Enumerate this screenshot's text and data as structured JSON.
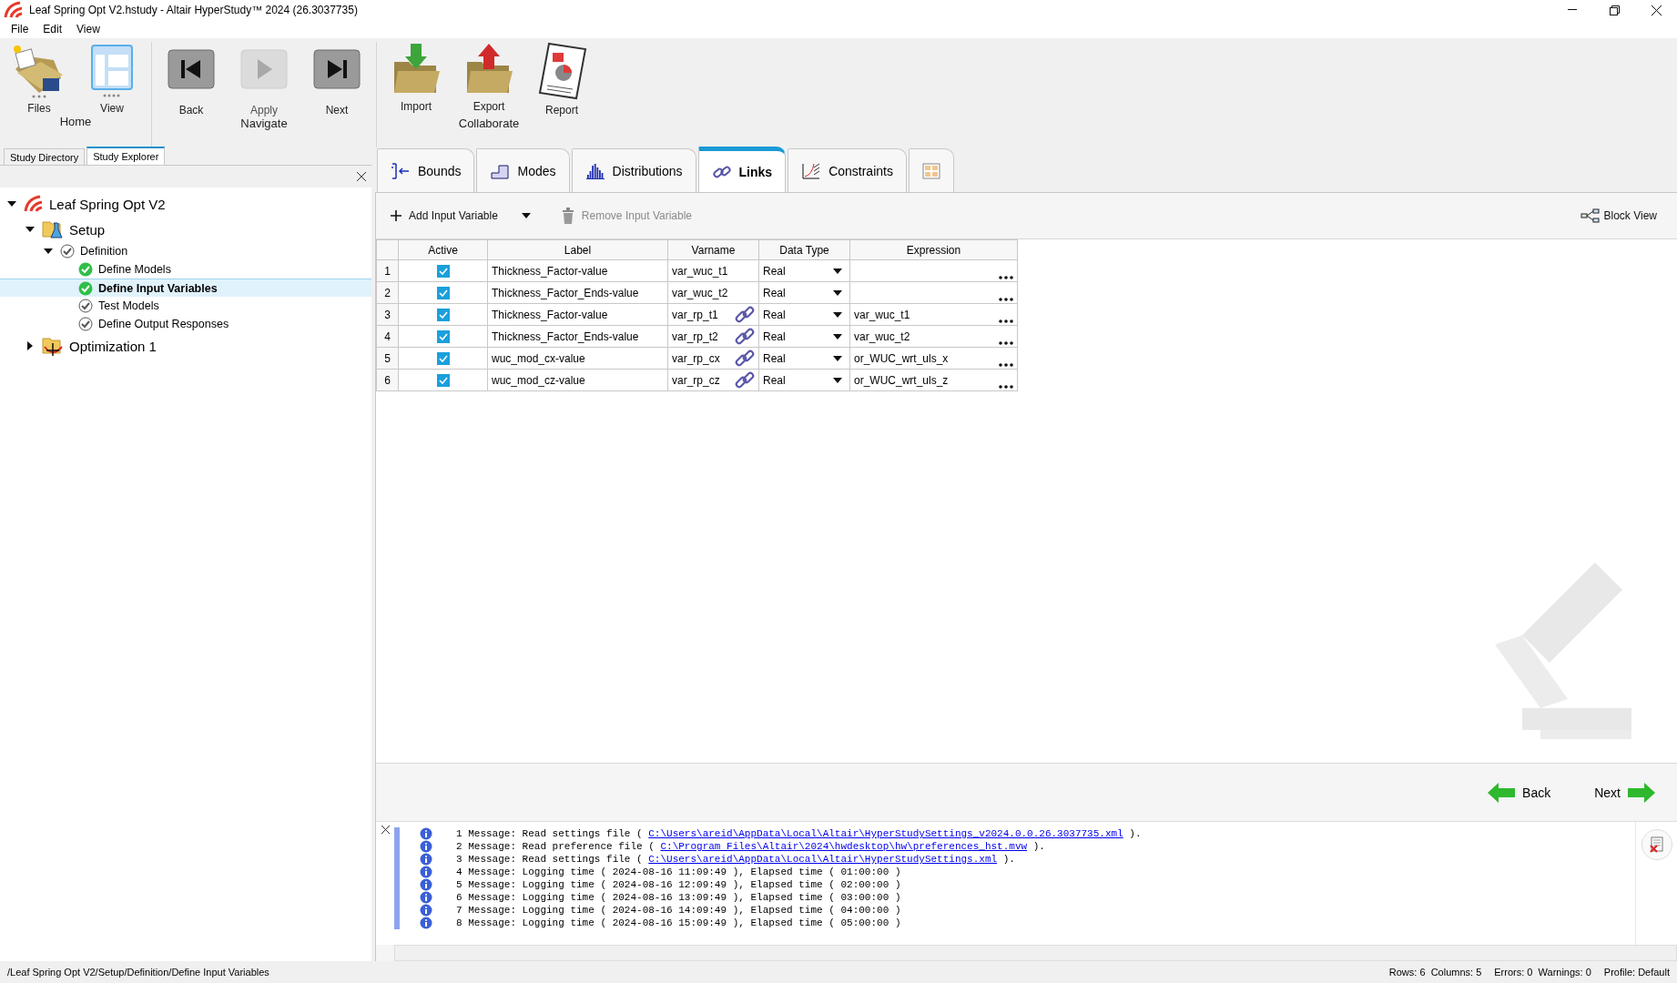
{
  "window": {
    "title": "Leaf Spring Opt V2.hstudy - Altair HyperStudy™ 2024 (26.3037735)"
  },
  "menu": [
    "File",
    "Edit",
    "View"
  ],
  "toolbar": [
    {
      "group": "Home",
      "buttons": [
        {
          "label": "Files",
          "kind": "files",
          "disabled": false
        },
        {
          "label": "View",
          "kind": "view",
          "disabled": false
        }
      ]
    },
    {
      "group": "Navigate",
      "buttons": [
        {
          "label": "Back",
          "kind": "back",
          "disabled": false
        },
        {
          "label": "Apply",
          "kind": "apply",
          "disabled": true
        },
        {
          "label": "Next",
          "kind": "next",
          "disabled": false
        }
      ]
    },
    {
      "group": "Collaborate",
      "buttons": [
        {
          "label": "Import",
          "kind": "import",
          "disabled": false
        },
        {
          "label": "Export",
          "kind": "export",
          "disabled": false
        },
        {
          "label": "Report",
          "kind": "report",
          "disabled": false
        }
      ]
    }
  ],
  "side_tabs": [
    {
      "label": "Study Directory",
      "selected": false
    },
    {
      "label": "Study Explorer",
      "selected": true
    }
  ],
  "tree": [
    {
      "label": "Leaf Spring Opt V2",
      "kind": "study",
      "expanded": true,
      "selected": false,
      "children": [
        {
          "label": "Setup",
          "kind": "setup",
          "expanded": true,
          "selected": false,
          "children": [
            {
              "label": "Definition",
              "kind": "step",
              "complete": false,
              "expanded": true,
              "selected": false,
              "children": [
                {
                  "label": "Define Models",
                  "kind": "step",
                  "complete": true,
                  "selected": false
                },
                {
                  "label": "Define Input Variables",
                  "kind": "step",
                  "complete": true,
                  "selected": true
                },
                {
                  "label": "Test Models",
                  "kind": "step",
                  "complete": false,
                  "selected": false
                },
                {
                  "label": "Define Output Responses",
                  "kind": "step",
                  "complete": false,
                  "selected": false
                }
              ]
            }
          ]
        },
        {
          "label": "Optimization 1",
          "kind": "optimization",
          "expanded": false,
          "selected": false
        }
      ]
    }
  ],
  "tabs": [
    {
      "label": "Bounds",
      "kind": "bounds",
      "selected": false
    },
    {
      "label": "Modes",
      "kind": "modes",
      "selected": false
    },
    {
      "label": "Distributions",
      "kind": "distributions",
      "selected": false
    },
    {
      "label": "Links",
      "kind": "links",
      "selected": true
    },
    {
      "label": "Constraints",
      "kind": "constraints",
      "selected": false
    },
    {
      "kind": "grid",
      "selected": false
    }
  ],
  "actions": [
    {
      "label": "Add Input Variable",
      "kind": "add",
      "disabled": false
    },
    {
      "label": "Remove Input Variable",
      "kind": "remove",
      "disabled": true
    }
  ],
  "block_view": "Block View",
  "table": {
    "columns": [
      "Active",
      "Label",
      "Varname",
      "Data Type",
      "Expression"
    ],
    "rows": [
      {
        "index": "1",
        "active": true,
        "label": "Thickness_Factor-value",
        "varname": "var_wuc_t1",
        "linked": false,
        "data_type": "Real"
      },
      {
        "index": "2",
        "active": true,
        "label": "Thickness_Factor_Ends-value",
        "varname": "var_wuc_t2",
        "linked": false,
        "data_type": "Real"
      },
      {
        "index": "3",
        "active": true,
        "label": "Thickness_Factor-value",
        "varname": "var_rp_t1",
        "linked": true,
        "data_type": "Real",
        "expression": "var_wuc_t1"
      },
      {
        "index": "4",
        "active": true,
        "label": "Thickness_Factor_Ends-value",
        "varname": "var_rp_t2",
        "linked": true,
        "data_type": "Real",
        "expression": "var_wuc_t2"
      },
      {
        "index": "5",
        "active": true,
        "label": "wuc_mod_cx-value",
        "varname": "var_rp_cx",
        "linked": true,
        "data_type": "Real",
        "expression": "or_WUC_wrt_uls_x"
      },
      {
        "index": "6",
        "active": true,
        "label": "wuc_mod_cz-value",
        "varname": "var_rp_cz",
        "linked": true,
        "data_type": "Real",
        "expression": "or_WUC_wrt_uls_z"
      }
    ]
  },
  "nav": {
    "back": "Back",
    "next": "Next"
  },
  "log": [
    {
      "text": "1 Message: Read settings file ( ",
      "link": "C:\\Users\\areid\\AppData\\Local\\Altair\\HyperStudySettings_v2024.0.0.26.3037735.xml",
      "suffix": " )."
    },
    {
      "text": "2 Message: Read preference file ( ",
      "link": "C:\\Program Files\\Altair\\2024\\hwdesktop\\hw\\preferences_hst.mvw",
      "suffix": " )."
    },
    {
      "text": "3 Message: Read settings file ( ",
      "link": "C:\\Users\\areid\\AppData\\Local\\Altair\\HyperStudySettings.xml",
      "suffix": " )."
    },
    {
      "text": "4 Message: Logging time ( 2024-08-16 11:09:49 ), Elapsed time ( 01:00:00 )"
    },
    {
      "text": "5 Message: Logging time ( 2024-08-16 12:09:49 ), Elapsed time ( 02:00:00 )"
    },
    {
      "text": "6 Message: Logging time ( 2024-08-16 13:09:49 ), Elapsed time ( 03:00:00 )"
    },
    {
      "text": "7 Message: Logging time ( 2024-08-16 14:09:49 ), Elapsed time ( 04:00:00 )"
    },
    {
      "text": "8 Message: Logging time ( 2024-08-16 15:09:49 ), Elapsed time ( 05:00:00 )"
    }
  ],
  "status_bar": {
    "path": "/Leaf Spring Opt V2/Setup/Definition/Define Input Variables",
    "items": [
      "Rows: 6  Columns: 5",
      "Errors: 0  Warnings: 0",
      "Profile: Default"
    ]
  }
}
